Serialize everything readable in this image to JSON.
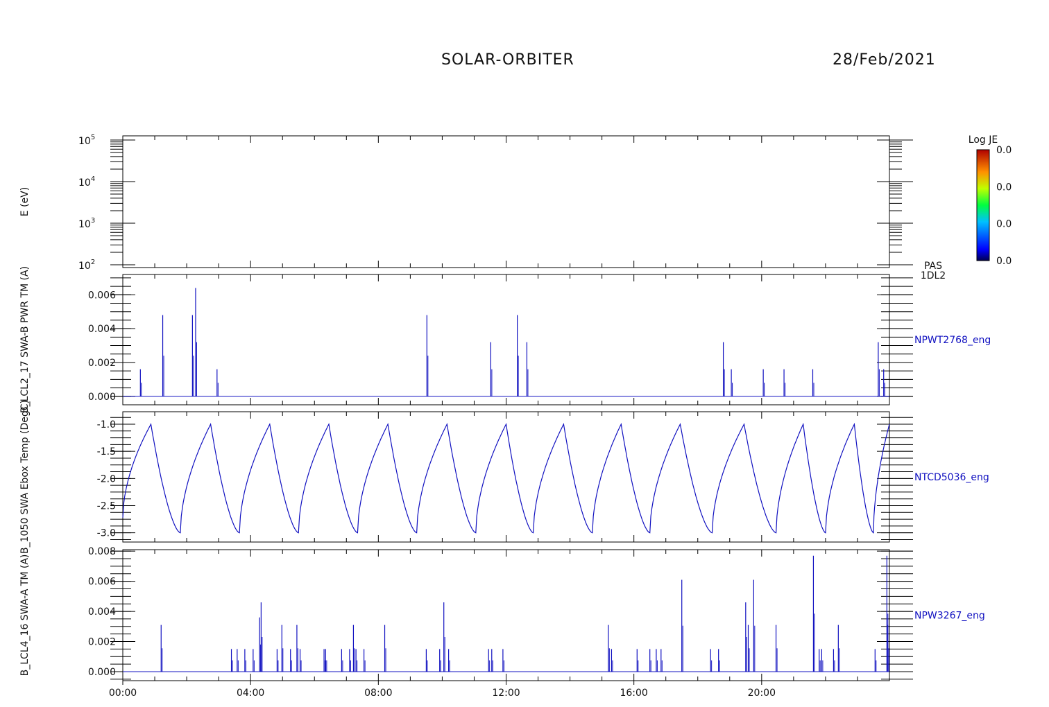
{
  "header": {
    "mission": "SOLAR-ORBITER",
    "date": "28/Feb/2021"
  },
  "colors": {
    "trace": "#1010c0",
    "axes": "#000000",
    "label_blue": "#1010c0"
  },
  "x_axis": {
    "range_hours": [
      0,
      24
    ],
    "tick_labels": [
      "00:00",
      "04:00",
      "08:00",
      "12:00",
      "16:00",
      "20:00"
    ]
  },
  "colorbar": {
    "title": "Log JE",
    "tick_labels": [
      "0.0",
      "0.0",
      "0.0",
      "0.0"
    ]
  },
  "chart_data": [
    {
      "type": "heatmap",
      "panel": 1,
      "ylabel": "E (eV)",
      "yscale": "log",
      "ylim": [
        100,
        100000
      ],
      "ytick_labels": [
        {
          "base": "10",
          "exp": "5"
        },
        {
          "base": "10",
          "exp": "4"
        },
        {
          "base": "10",
          "exp": "3"
        },
        {
          "base": "10",
          "exp": "2"
        }
      ],
      "right_label": [
        "PAS",
        "1DL2"
      ],
      "values": []
    },
    {
      "type": "line",
      "panel": 2,
      "ylabel": "B_LCL2_17 SWA-B PWR TM (A)",
      "ylim": [
        -0.0005,
        0.0072
      ],
      "ytick_labels": [
        "0.006",
        "0.004",
        "0.002",
        "0.000"
      ],
      "right_label": "NPWT2768_eng",
      "baseline": 0.0,
      "spikes": [
        {
          "x": 0.55,
          "y": 0.0016
        },
        {
          "x": 1.25,
          "y": 0.0048
        },
        {
          "x": 2.18,
          "y": 0.0048
        },
        {
          "x": 2.28,
          "y": 0.0064
        },
        {
          "x": 2.95,
          "y": 0.0016
        },
        {
          "x": 9.52,
          "y": 0.0048
        },
        {
          "x": 11.52,
          "y": 0.0032
        },
        {
          "x": 12.35,
          "y": 0.0048
        },
        {
          "x": 12.65,
          "y": 0.0032
        },
        {
          "x": 18.8,
          "y": 0.0032
        },
        {
          "x": 19.05,
          "y": 0.0016
        },
        {
          "x": 20.05,
          "y": 0.0016
        },
        {
          "x": 20.7,
          "y": 0.0016
        },
        {
          "x": 21.6,
          "y": 0.0016
        },
        {
          "x": 23.65,
          "y": 0.0032
        },
        {
          "x": 23.82,
          "y": 0.0016
        }
      ]
    },
    {
      "type": "line",
      "panel": 3,
      "ylabel": "B_1050 SWA Ebox Temp (DegC)",
      "ylim": [
        -3.17,
        -0.77
      ],
      "ytick_labels": [
        "-1.0",
        "-1.5",
        "-2.0",
        "-2.5",
        "-3.0"
      ],
      "right_label": "NTCD5036_eng",
      "x": [
        0.0,
        0.88,
        1.8,
        2.75,
        3.65,
        4.6,
        5.5,
        6.45,
        7.35,
        8.3,
        9.2,
        10.15,
        11.05,
        12.0,
        12.85,
        13.8,
        14.7,
        15.6,
        16.5,
        17.45,
        18.45,
        19.45,
        20.45,
        21.3,
        22.0,
        22.9,
        23.5,
        24.0
      ],
      "y": [
        -2.72,
        -1.0,
        -3.0,
        -1.0,
        -3.0,
        -1.0,
        -3.0,
        -1.0,
        -3.0,
        -1.0,
        -3.0,
        -1.0,
        -3.0,
        -1.0,
        -3.0,
        -1.0,
        -3.0,
        -1.0,
        -3.0,
        -1.0,
        -3.0,
        -1.0,
        -3.0,
        -1.0,
        -3.0,
        -1.0,
        -3.0,
        -1.0
      ],
      "y_segments_note": ""
    },
    {
      "type": "line",
      "panel": 4,
      "ylabel": "B_LCL4_16 SWA-A TM (A)",
      "ylim": [
        -0.0006,
        0.0081
      ],
      "ytick_labels": [
        "0.008",
        "0.006",
        "0.004",
        "0.002",
        "0.000"
      ],
      "right_label": "NPW3267_eng",
      "baseline": 0.0,
      "spikes": [
        {
          "x": 1.2,
          "y": 0.0031
        },
        {
          "x": 3.4,
          "y": 0.0015
        },
        {
          "x": 3.58,
          "y": 0.0015
        },
        {
          "x": 3.82,
          "y": 0.0015
        },
        {
          "x": 4.08,
          "y": 0.0015
        },
        {
          "x": 4.28,
          "y": 0.0036
        },
        {
          "x": 4.33,
          "y": 0.0046
        },
        {
          "x": 4.83,
          "y": 0.0015
        },
        {
          "x": 4.98,
          "y": 0.0031
        },
        {
          "x": 5.25,
          "y": 0.0015
        },
        {
          "x": 5.45,
          "y": 0.0031
        },
        {
          "x": 5.55,
          "y": 0.0015
        },
        {
          "x": 6.3,
          "y": 0.0015
        },
        {
          "x": 6.35,
          "y": 0.0015
        },
        {
          "x": 6.85,
          "y": 0.0015
        },
        {
          "x": 7.1,
          "y": 0.0015
        },
        {
          "x": 7.22,
          "y": 0.0031
        },
        {
          "x": 7.3,
          "y": 0.0015
        },
        {
          "x": 7.55,
          "y": 0.0015
        },
        {
          "x": 8.2,
          "y": 0.0031
        },
        {
          "x": 9.5,
          "y": 0.0015
        },
        {
          "x": 9.92,
          "y": 0.0015
        },
        {
          "x": 10.05,
          "y": 0.0046
        },
        {
          "x": 10.2,
          "y": 0.0015
        },
        {
          "x": 11.45,
          "y": 0.0015
        },
        {
          "x": 11.55,
          "y": 0.0015
        },
        {
          "x": 11.9,
          "y": 0.0015
        },
        {
          "x": 15.2,
          "y": 0.0031
        },
        {
          "x": 15.3,
          "y": 0.0015
        },
        {
          "x": 16.1,
          "y": 0.0015
        },
        {
          "x": 16.5,
          "y": 0.0015
        },
        {
          "x": 16.7,
          "y": 0.0015
        },
        {
          "x": 16.85,
          "y": 0.0015
        },
        {
          "x": 17.5,
          "y": 0.0061
        },
        {
          "x": 18.4,
          "y": 0.0015
        },
        {
          "x": 18.65,
          "y": 0.0015
        },
        {
          "x": 19.5,
          "y": 0.0046
        },
        {
          "x": 19.58,
          "y": 0.0031
        },
        {
          "x": 19.75,
          "y": 0.0061
        },
        {
          "x": 20.45,
          "y": 0.0031
        },
        {
          "x": 21.62,
          "y": 0.0077
        },
        {
          "x": 21.8,
          "y": 0.0015
        },
        {
          "x": 21.88,
          "y": 0.0015
        },
        {
          "x": 22.25,
          "y": 0.0015
        },
        {
          "x": 22.4,
          "y": 0.0031
        },
        {
          "x": 23.55,
          "y": 0.0015
        },
        {
          "x": 23.92,
          "y": 0.0077
        },
        {
          "x": 23.95,
          "y": 0.0031
        }
      ]
    }
  ]
}
